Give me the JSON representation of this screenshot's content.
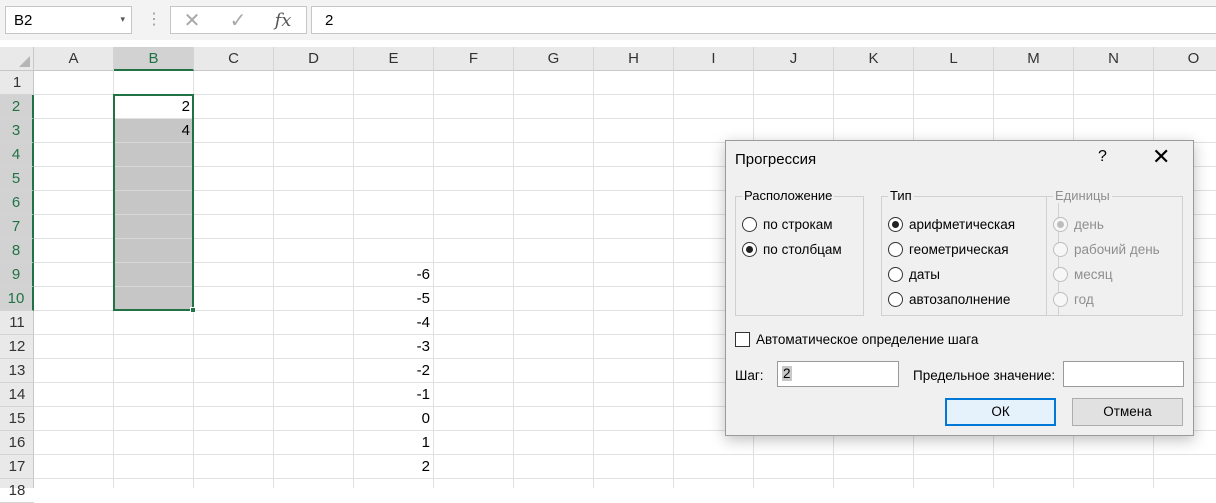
{
  "formula_bar": {
    "name_box": "B2",
    "name_box_arrow": "▾",
    "separator": "⋮",
    "cancel_icon": "✕",
    "enter_icon": "✓",
    "function_icon": "fx",
    "formula_value": "2"
  },
  "columns": [
    "A",
    "B",
    "C",
    "D",
    "E",
    "F",
    "G",
    "H",
    "I",
    "J",
    "K",
    "L",
    "M",
    "N",
    "O"
  ],
  "selected_column": "B",
  "rows": [
    "1",
    "2",
    "3",
    "4",
    "5",
    "6",
    "7",
    "8",
    "9",
    "10",
    "11",
    "12",
    "13",
    "14",
    "15",
    "16",
    "17",
    "18"
  ],
  "selected_rows": [
    "2",
    "3",
    "4",
    "5",
    "6",
    "7",
    "8",
    "9",
    "10"
  ],
  "cells": {
    "B2": "2",
    "B3": "4",
    "E9": "-6",
    "E10": "-5",
    "E11": "-4",
    "E12": "-3",
    "E13": "-2",
    "E14": "-1",
    "E15": "0",
    "E16": "1",
    "E17": "2"
  },
  "dialog": {
    "title": "Прогрессия",
    "help_label": "?",
    "close_label": "✕",
    "placement": {
      "label": "Расположение",
      "options": [
        {
          "label": "по строкам",
          "selected": false
        },
        {
          "label": "по столбцам",
          "selected": true
        }
      ]
    },
    "type": {
      "label": "Тип",
      "options": [
        {
          "label": "арифметическая",
          "selected": true
        },
        {
          "label": "геометрическая",
          "selected": false
        },
        {
          "label": "даты",
          "selected": false
        },
        {
          "label": "автозаполнение",
          "selected": false
        }
      ]
    },
    "units": {
      "label": "Единицы",
      "disabled": true,
      "options": [
        {
          "label": "день",
          "selected": true
        },
        {
          "label": "рабочий день",
          "selected": false
        },
        {
          "label": "месяц",
          "selected": false
        },
        {
          "label": "год",
          "selected": false
        }
      ]
    },
    "auto_step": {
      "label": "Автоматическое определение шага",
      "checked": false
    },
    "step": {
      "label": "Шаг:",
      "value": "2"
    },
    "limit": {
      "label": "Предельное значение:",
      "value": ""
    },
    "ok_label": "ОК",
    "cancel_label": "Отмена"
  },
  "colors": {
    "accent": "#217346",
    "selection_fill": "#c6c6c6",
    "dialog_default_border": "#0078d7"
  }
}
